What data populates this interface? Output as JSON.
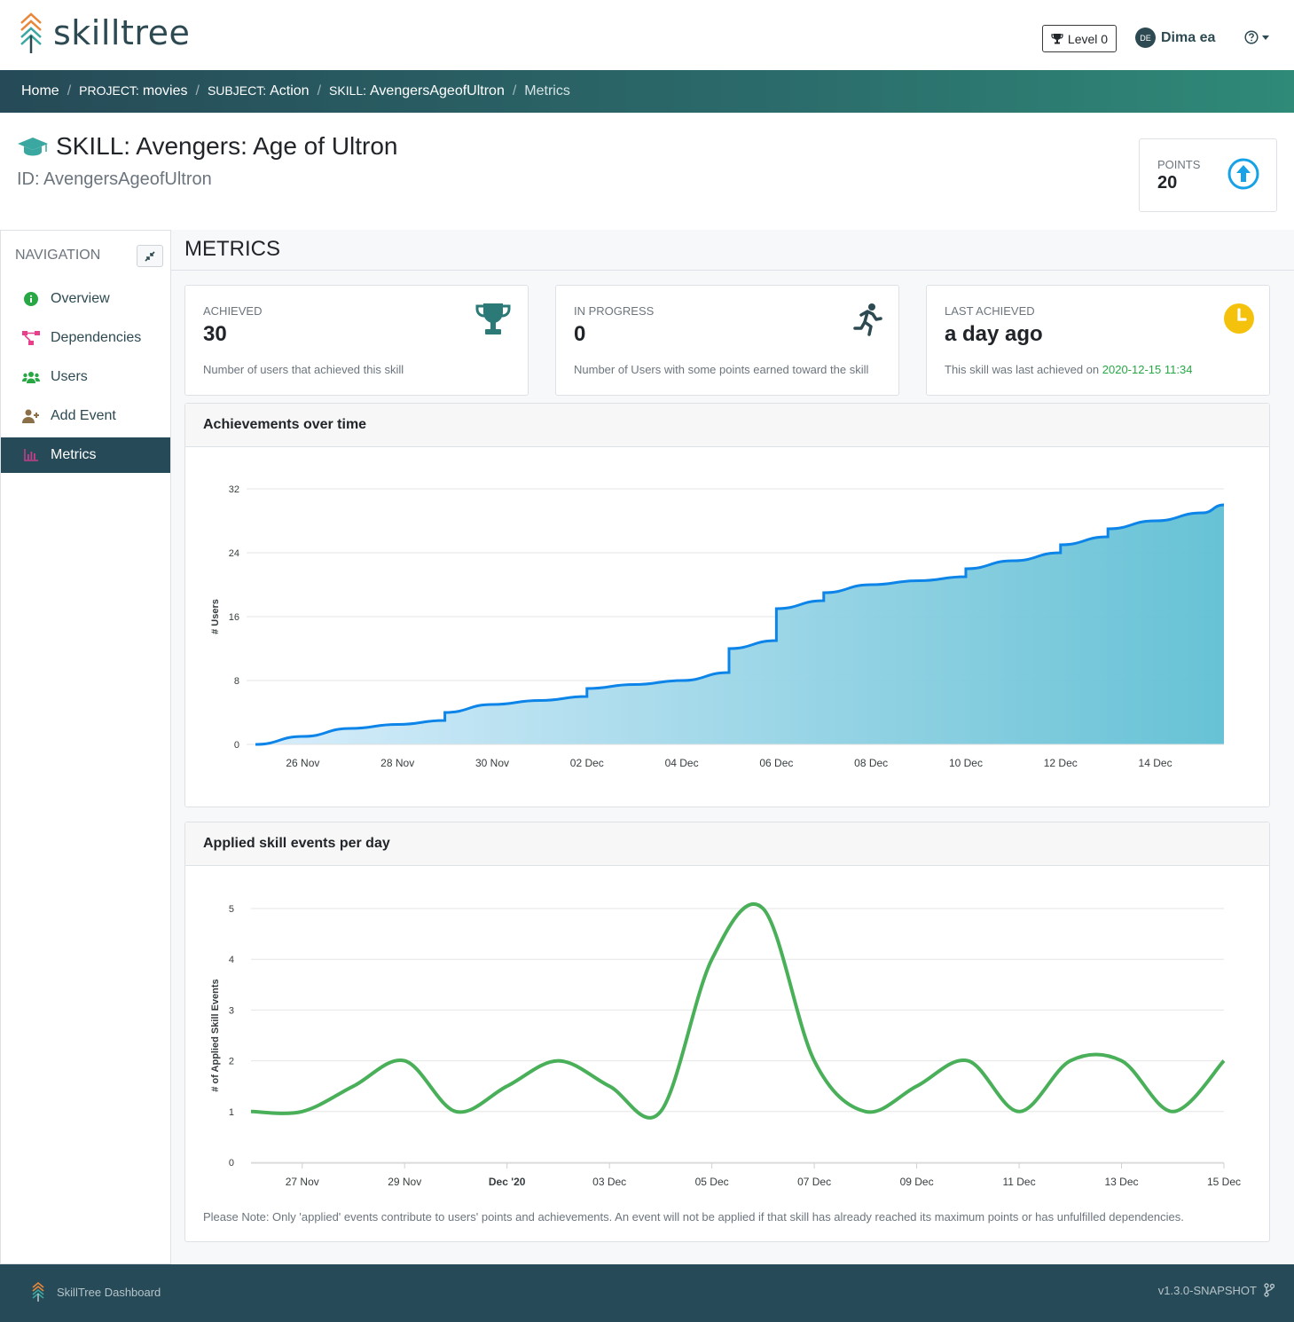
{
  "header": {
    "logo_text": "skilltree",
    "level_label": "Level 0",
    "user_initials": "DE",
    "user_name": "Dima ea"
  },
  "breadcrumb": {
    "home": "Home",
    "project_prefix": "Project:",
    "project": "movies",
    "subject_prefix": "Subject:",
    "subject": "Action",
    "skill_prefix": "Skill:",
    "skill": "AvengersAgeofUltron",
    "current": "Metrics"
  },
  "skill": {
    "title": "SKILL: Avengers: Age of Ultron",
    "id_label": "ID: AvengersAgeofUltron",
    "points_label": "Points",
    "points_value": "20"
  },
  "nav": {
    "title": "Navigation",
    "items": [
      {
        "label": "Overview",
        "icon": "info-circle-icon",
        "color": "#28a745"
      },
      {
        "label": "Dependencies",
        "icon": "project-diagram-icon",
        "color": "#e83e8c"
      },
      {
        "label": "Users",
        "icon": "users-icon",
        "color": "#28a745"
      },
      {
        "label": "Add Event",
        "icon": "user-plus-icon",
        "color": "#8b6f47"
      },
      {
        "label": "Metrics",
        "icon": "chart-bar-icon",
        "color": "#c63e8c"
      }
    ]
  },
  "main": {
    "title": "Metrics"
  },
  "stats": {
    "achieved": {
      "label": "Achieved",
      "value": "30",
      "desc": "Number of users that achieved this skill"
    },
    "in_progress": {
      "label": "In Progress",
      "value": "0",
      "desc": "Number of Users with some points earned toward the skill"
    },
    "last_achieved": {
      "label": "Last Achieved",
      "value": "a day ago",
      "desc_prefix": "This skill was last achieved on ",
      "desc_date": "2020-12-15 11:34"
    }
  },
  "colors": {
    "teal": "#2b7a78",
    "blue_line": "#0d84e8",
    "green_line": "#49b059",
    "gold": "#f4c20d",
    "cyan": "#17a2e8"
  },
  "chart_data": [
    {
      "type": "area",
      "title": "Achievements over time",
      "ylabel": "# Users",
      "xlabel": "",
      "ylim": [
        0,
        32
      ],
      "yticks": [
        0,
        8,
        16,
        24,
        32
      ],
      "xticks": [
        "26 Nov",
        "28 Nov",
        "30 Nov",
        "02 Dec",
        "04 Dec",
        "06 Dec",
        "08 Dec",
        "10 Dec",
        "12 Dec",
        "14 Dec"
      ],
      "x_start": "2020-11-25",
      "x_end": "2020-12-15",
      "series": [
        {
          "x": [
            "2020-11-25",
            "2020-11-26",
            "2020-11-27",
            "2020-11-28",
            "2020-11-29",
            "2020-11-29",
            "2020-11-30",
            "2020-12-01",
            "2020-12-02",
            "2020-12-02",
            "2020-12-03",
            "2020-12-04",
            "2020-12-05",
            "2020-12-05",
            "2020-12-06",
            "2020-12-06",
            "2020-12-07",
            "2020-12-07",
            "2020-12-08",
            "2020-12-09",
            "2020-12-10",
            "2020-12-10",
            "2020-12-11",
            "2020-12-12",
            "2020-12-12",
            "2020-12-13",
            "2020-12-13",
            "2020-12-14",
            "2020-12-15",
            "2020-12-15"
          ],
          "y": [
            0,
            1,
            2,
            2.5,
            3,
            4,
            5,
            5.5,
            6,
            7,
            7.5,
            8,
            9,
            12,
            13,
            17,
            18,
            19,
            20,
            20.5,
            21,
            22,
            23,
            24,
            25,
            26,
            27,
            28,
            29,
            30
          ]
        }
      ]
    },
    {
      "type": "line",
      "title": "Applied skill events per day",
      "ylabel": "# of Applied Skill Events",
      "xlabel": "",
      "ylim": [
        0,
        5
      ],
      "yticks": [
        0,
        1,
        2,
        3,
        4,
        5
      ],
      "xticks": [
        "27 Nov",
        "29 Nov",
        "Dec '20",
        "03 Dec",
        "05 Dec",
        "07 Dec",
        "09 Dec",
        "11 Dec",
        "13 Dec",
        "15 Dec"
      ],
      "x_start": "2020-11-26",
      "x_end": "2020-12-15",
      "series": [
        {
          "x": [
            "2020-11-26",
            "2020-11-27",
            "2020-11-28",
            "2020-11-29",
            "2020-11-30",
            "2020-12-01",
            "2020-12-02",
            "2020-12-03",
            "2020-12-04",
            "2020-12-05",
            "2020-12-06",
            "2020-12-07",
            "2020-12-08",
            "2020-12-09",
            "2020-12-10",
            "2020-12-11",
            "2020-12-12",
            "2020-12-13",
            "2020-12-14",
            "2020-12-15"
          ],
          "y": [
            1,
            1,
            1.5,
            2,
            1,
            1.5,
            2,
            1.5,
            1,
            4,
            5,
            2,
            1,
            1.5,
            2,
            1,
            2,
            2,
            1,
            2
          ]
        }
      ]
    }
  ],
  "charts": {
    "achievements_title": "Achievements over time",
    "events_title": "Applied skill events per day",
    "note": "Please Note: Only 'applied' events contribute to users' points and achievements. An event will not be applied if that skill has already reached its maximum points or has unfulfilled dependencies."
  },
  "footer": {
    "label": "SkillTree Dashboard",
    "version": "v1.3.0-SNAPSHOT"
  }
}
